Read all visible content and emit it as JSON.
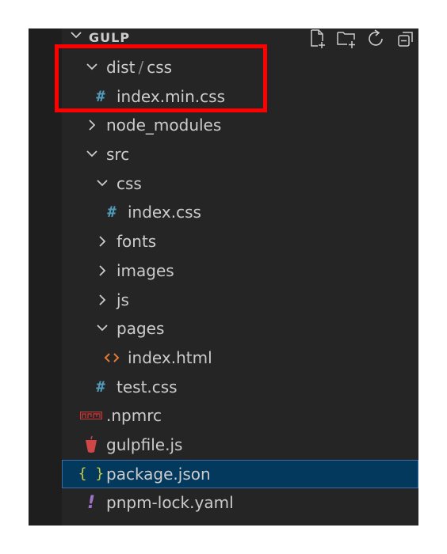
{
  "explorer": {
    "title": "GULP",
    "actions": [
      {
        "name": "new-file-icon"
      },
      {
        "name": "new-folder-icon"
      },
      {
        "name": "refresh-icon"
      },
      {
        "name": "collapse-all-icon"
      }
    ]
  },
  "tree": {
    "dist_css": {
      "part1": "dist",
      "separator": "/",
      "part2": "css",
      "icon": "chevron-down-icon"
    },
    "index_min_css": {
      "label": "index.min.css",
      "icon": "css-hash-icon",
      "glyph": "#"
    },
    "node_modules": {
      "label": "node_modules",
      "icon": "chevron-right-icon"
    },
    "src": {
      "label": "src",
      "icon": "chevron-down-icon"
    },
    "src_css": {
      "label": "css",
      "icon": "chevron-down-icon"
    },
    "index_css": {
      "label": "index.css",
      "icon": "css-hash-icon",
      "glyph": "#"
    },
    "fonts": {
      "label": "fonts",
      "icon": "chevron-right-icon"
    },
    "images": {
      "label": "images",
      "icon": "chevron-right-icon"
    },
    "js": {
      "label": "js",
      "icon": "chevron-right-icon"
    },
    "pages": {
      "label": "pages",
      "icon": "chevron-down-icon"
    },
    "index_html": {
      "label": "index.html",
      "icon": "html-code-icon"
    },
    "test_css": {
      "label": "test.css",
      "icon": "css-hash-icon",
      "glyph": "#"
    },
    "npmrc": {
      "label": ".npmrc",
      "icon": "npm-icon"
    },
    "gulpfile": {
      "label": "gulpfile.js",
      "icon": "gulp-cup-icon"
    },
    "package_json": {
      "label": "package.json",
      "icon": "json-braces-icon",
      "glyph": "{ }",
      "selected": true
    },
    "pnpm_lock": {
      "label": "pnpm-lock.yaml",
      "icon": "yaml-exclamation-icon",
      "glyph": "!"
    }
  },
  "colors": {
    "panel_bg": "#252526",
    "text": "#cccccc",
    "selected_bg": "#04395e",
    "annotation_red": "#ff0000",
    "css_icon": "#519aba",
    "json_icon": "#cbcb41",
    "html_icon": "#e37933",
    "npm_icon": "#cb3837",
    "gulp_icon": "#cf4647",
    "yaml_icon": "#a074c4"
  }
}
